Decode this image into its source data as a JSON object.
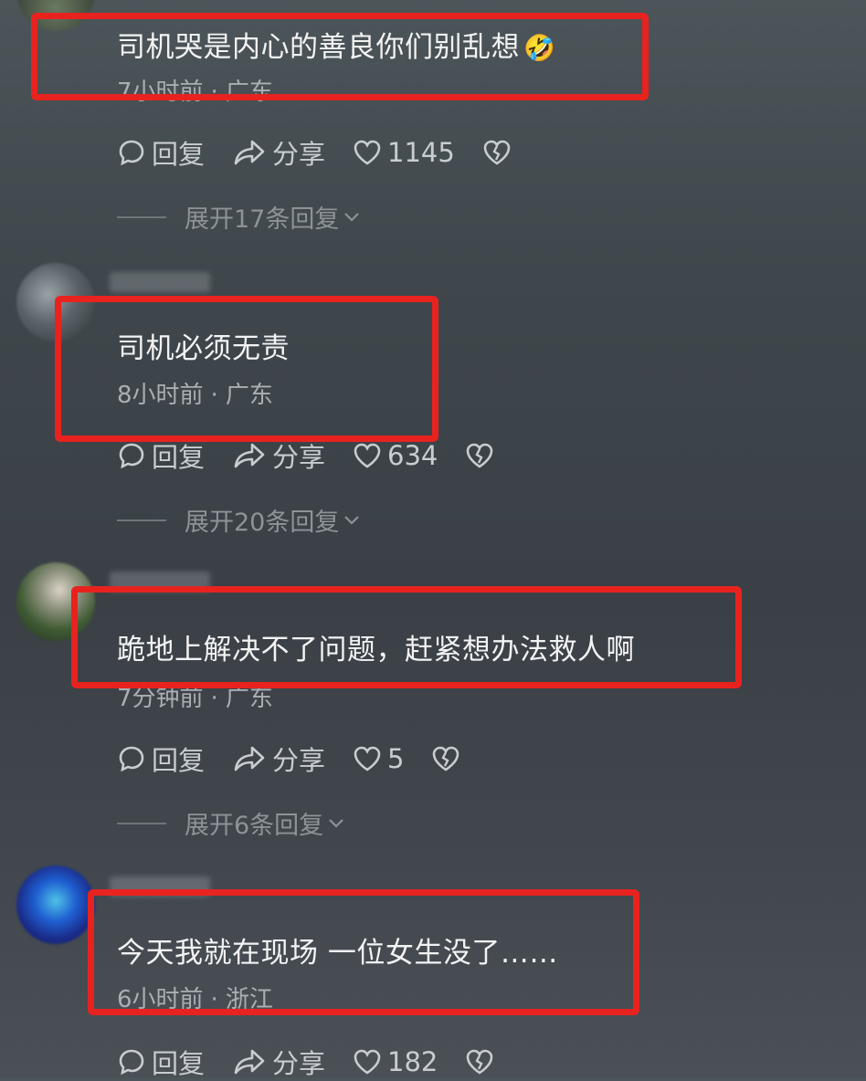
{
  "comments": [
    {
      "text": "司机哭是内心的善良你们别乱想",
      "emoji": "🤣",
      "time": "7小时前",
      "location": "广东",
      "reply_label": "回复",
      "share_label": "分享",
      "likes": "1145",
      "expand_label": "展开17条回复"
    },
    {
      "text": "司机必须无责",
      "time": "8小时前",
      "location": "广东",
      "reply_label": "回复",
      "share_label": "分享",
      "likes": "634",
      "expand_label": "展开20条回复"
    },
    {
      "text": "跪地上解决不了问题，赶紧想办法救人啊",
      "time": "7分钟前",
      "location": "广东",
      "reply_label": "回复",
      "share_label": "分享",
      "likes": "5",
      "expand_label": "展开6条回复"
    },
    {
      "text": "今天我就在现场 一位女生没了……",
      "time": "6小时前",
      "location": "浙江",
      "reply_label": "回复",
      "share_label": "分享",
      "likes": "182"
    }
  ],
  "separator": "·",
  "colors": {
    "highlight": "#e8231f",
    "text": "#f3f3f3",
    "meta": "#a9afb3"
  },
  "icons": [
    "comment-icon",
    "share-icon",
    "heart-icon",
    "broken-heart-icon",
    "chevron-down-icon"
  ]
}
